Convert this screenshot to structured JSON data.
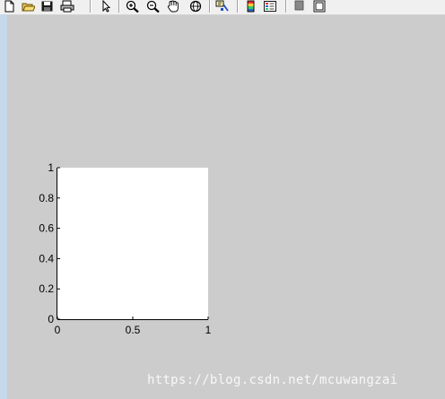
{
  "toolbar": {
    "buttons": [
      {
        "icon": "new-file-icon"
      },
      {
        "icon": "open-folder-icon"
      },
      {
        "icon": "save-icon"
      },
      {
        "icon": "print-icon"
      },
      {
        "icon": "select-arrow-icon"
      },
      {
        "icon": "zoom-in-icon"
      },
      {
        "icon": "zoom-out-icon"
      },
      {
        "icon": "pan-hand-icon"
      },
      {
        "icon": "rotate-3d-icon"
      },
      {
        "icon": "data-cursor-icon"
      },
      {
        "icon": "colorbar-icon"
      },
      {
        "icon": "legend-icon"
      },
      {
        "icon": "hide-plot-tools-icon"
      },
      {
        "icon": "show-plot-tools-icon"
      }
    ]
  },
  "chart_data": {
    "type": "line",
    "series": [],
    "xlim": [
      0,
      1
    ],
    "ylim": [
      0,
      1
    ],
    "xticks": [
      "0",
      "0.5",
      "1"
    ],
    "yticks": [
      "0",
      "0.2",
      "0.4",
      "0.6",
      "0.8",
      "1"
    ],
    "grid": false,
    "background": "#ffffff"
  },
  "watermark": "https://blog.csdn.net/mcuwangzai"
}
